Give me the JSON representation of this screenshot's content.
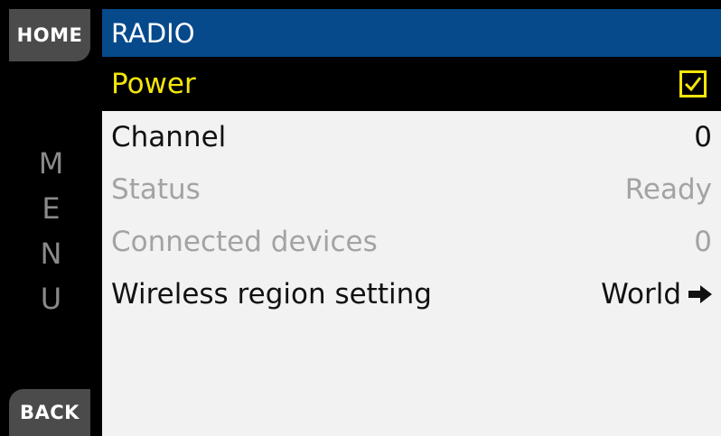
{
  "sidebar": {
    "home_label": "HOME",
    "menu_letters": [
      "M",
      "E",
      "N",
      "U"
    ],
    "back_label": "BACK"
  },
  "header": {
    "title": "RADIO"
  },
  "rows": [
    {
      "label": "Power",
      "value_icon": "checkbox-checked-icon",
      "checked": true
    },
    {
      "label": "Channel",
      "value": "0"
    },
    {
      "label": "Status",
      "value": "Ready"
    },
    {
      "label": "Connected devices",
      "value": "0"
    },
    {
      "label": "Wireless region setting",
      "value": "World",
      "value_icon": "arrow-right-icon"
    }
  ],
  "colors": {
    "header_bg": "#064a8c",
    "highlight_text": "#f2e60b",
    "disabled_text": "#a3a3a3"
  }
}
